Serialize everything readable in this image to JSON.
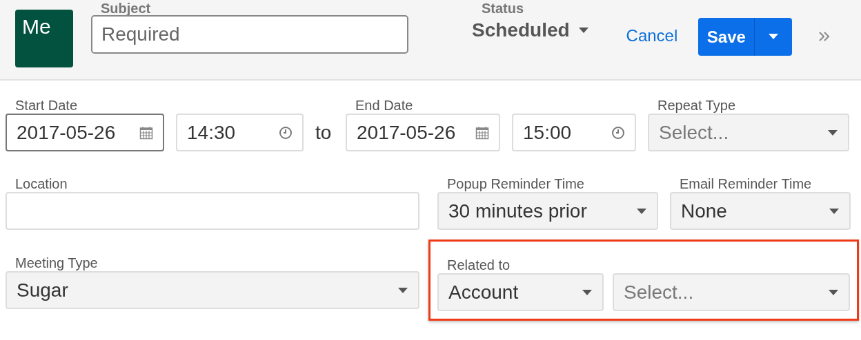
{
  "header": {
    "avatar": "Me",
    "subject": {
      "label": "Subject",
      "placeholder": "Required"
    },
    "status": {
      "label": "Status",
      "value": "Scheduled"
    },
    "cancel": "Cancel",
    "save": "Save"
  },
  "rows": [
    [
      {
        "kind": "date",
        "label": "Start Date",
        "value": "2017-05-26",
        "focused": true
      },
      {
        "kind": "time",
        "value": "14:30",
        "focused": false
      },
      {
        "kind": "separator",
        "text": "to"
      },
      {
        "kind": "date",
        "label": "End Date",
        "value": "2017-05-26",
        "focused": false
      },
      {
        "kind": "time",
        "value": "15:00",
        "focused": false
      },
      {
        "kind": "select",
        "label": "Repeat Type",
        "placeholder": "Select..."
      }
    ],
    [
      {
        "kind": "text",
        "label": "Location",
        "focused": false
      },
      {
        "kind": "select",
        "label": "Popup Reminder Time",
        "value": "30 minutes prior"
      },
      {
        "kind": "select",
        "label": "Email Reminder Time",
        "value": "None"
      }
    ],
    [
      {
        "kind": "select",
        "label": "Meeting Type",
        "value": "Sugar"
      },
      {
        "kind": "group",
        "label": "Related to",
        "highlighted": true,
        "items": [
          {
            "value": "Account"
          },
          {
            "placeholder": "Select..."
          }
        ]
      }
    ]
  ]
}
